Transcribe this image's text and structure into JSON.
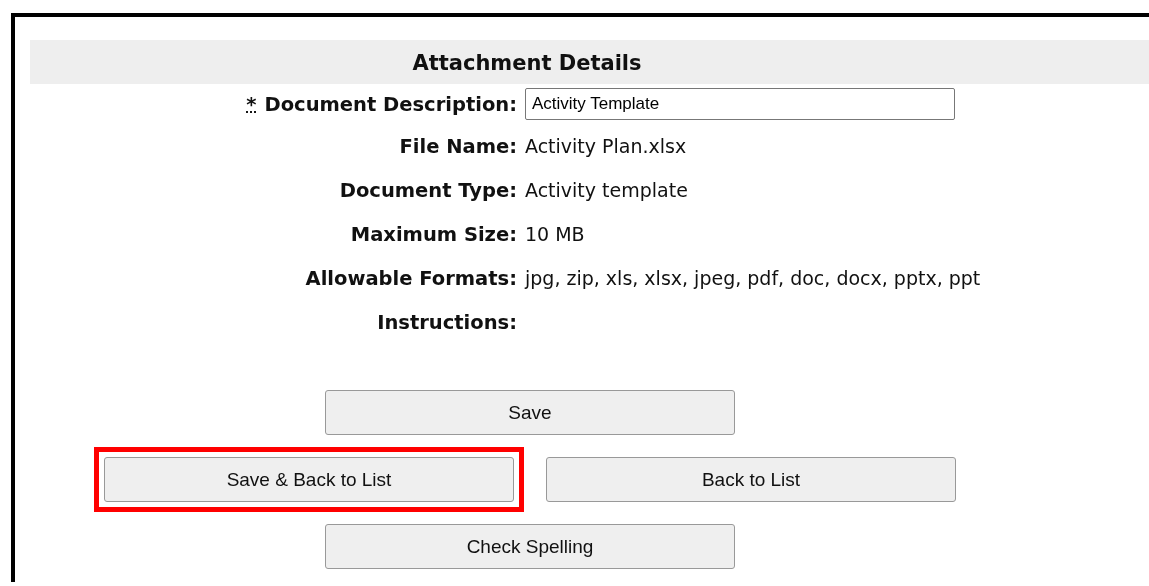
{
  "section_title": "Attachment Details",
  "fields": [
    {
      "kind": "input",
      "label": "Document Description:",
      "required_mark": "*",
      "value": "Activity Template"
    },
    {
      "kind": "text",
      "label": "File Name:",
      "value": "Activity Plan.xlsx"
    },
    {
      "kind": "text",
      "label": "Document Type:",
      "value": "Activity template"
    },
    {
      "kind": "text",
      "label": "Maximum Size:",
      "value": "10 MB"
    },
    {
      "kind": "text",
      "label": "Allowable Formats:",
      "value": "jpg, zip, xls, xlsx, jpeg, pdf, doc, docx, pptx, ppt"
    },
    {
      "kind": "text",
      "label": "Instructions:"
    }
  ],
  "button_rows": [
    [
      {
        "label": "Save",
        "highlighted": false
      }
    ],
    [
      {
        "label": "Save & Back to List",
        "highlighted": true
      },
      {
        "label": "Back to List",
        "highlighted": false
      }
    ],
    [
      {
        "label": "Check Spelling",
        "highlighted": false
      }
    ]
  ]
}
